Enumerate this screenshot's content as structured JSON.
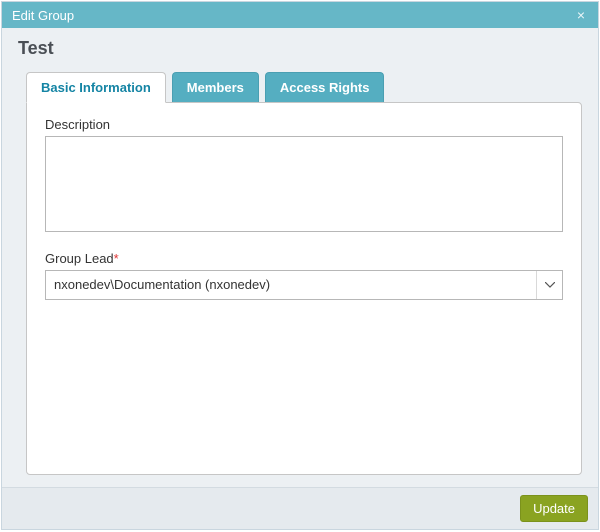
{
  "dialog": {
    "title": "Edit Group",
    "close_glyph": "×"
  },
  "group": {
    "name": "Test"
  },
  "tabs": {
    "basic": "Basic Information",
    "members": "Members",
    "access": "Access Rights"
  },
  "form": {
    "description_label": "Description",
    "description_value": "",
    "group_lead_label": "Group Lead",
    "group_lead_required_mark": "*",
    "group_lead_value": "nxonedev\\Documentation (nxonedev)"
  },
  "footer": {
    "update_label": "Update"
  }
}
